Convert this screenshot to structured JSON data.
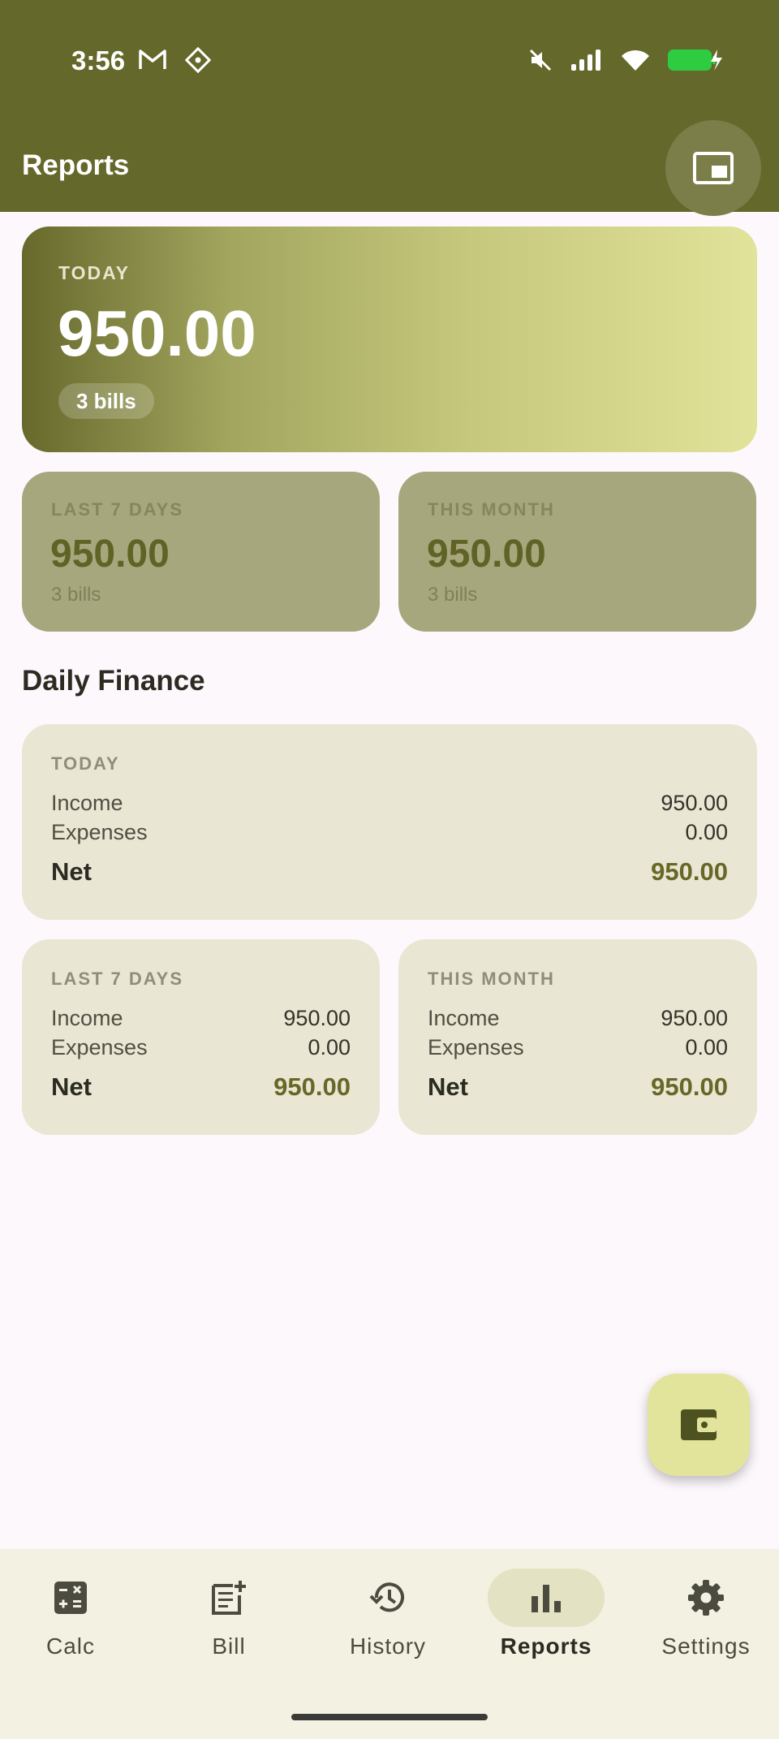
{
  "status_bar": {
    "time": "3:56"
  },
  "app_bar": {
    "title": "Reports"
  },
  "hero": {
    "label": "TODAY",
    "amount": "950.00",
    "bills": "3 bills"
  },
  "summary": [
    {
      "label": "LAST 7 DAYS",
      "amount": "950.00",
      "bills": "3 bills"
    },
    {
      "label": "THIS MONTH",
      "amount": "950.00",
      "bills": "3 bills"
    }
  ],
  "daily_finance": {
    "title": "Daily Finance",
    "today": {
      "label": "TODAY",
      "income_label": "Income",
      "income": "950.00",
      "expenses_label": "Expenses",
      "expenses": "0.00",
      "net_label": "Net",
      "net": "950.00"
    },
    "last7": {
      "label": "LAST 7 DAYS",
      "income_label": "Income",
      "income": "950.00",
      "expenses_label": "Expenses",
      "expenses": "0.00",
      "net_label": "Net",
      "net": "950.00"
    },
    "month": {
      "label": "THIS MONTH",
      "income_label": "Income",
      "income": "950.00",
      "expenses_label": "Expenses",
      "expenses": "0.00",
      "net_label": "Net",
      "net": "950.00"
    }
  },
  "nav": [
    {
      "label": "Calc",
      "icon": "calculator-icon"
    },
    {
      "label": "Bill",
      "icon": "bill-icon"
    },
    {
      "label": "History",
      "icon": "history-icon"
    },
    {
      "label": "Reports",
      "icon": "bar-chart-icon",
      "active": true
    },
    {
      "label": "Settings",
      "icon": "gear-icon"
    }
  ],
  "colors": {
    "primary": "#65682B",
    "accent": "#E3E49B",
    "card": "#E9E6D4"
  }
}
